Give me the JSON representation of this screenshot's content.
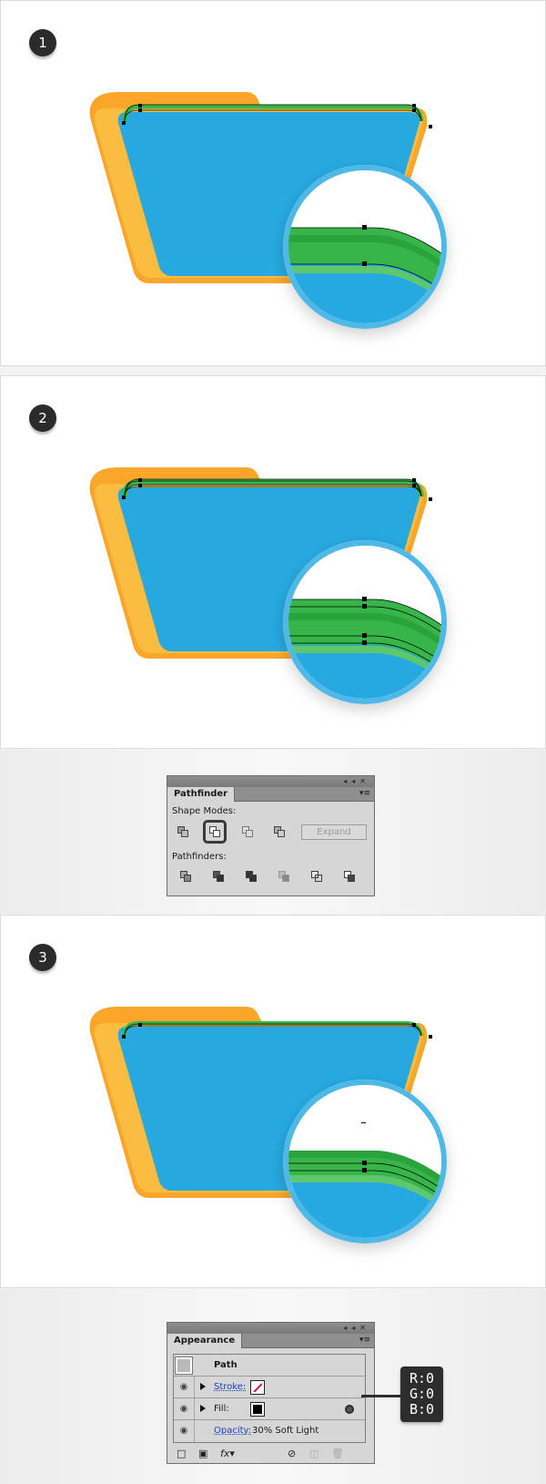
{
  "steps": [
    {
      "number": "1"
    },
    {
      "number": "2"
    },
    {
      "number": "3"
    }
  ],
  "colors": {
    "folder_back": "#f9a62b",
    "folder_front": "#27a9e0",
    "folder_rim": "#fbbd40",
    "green_strip": "#39b54a",
    "green_dark": "#2aa33c",
    "green_light": "#5dc76e",
    "badge_bg": "#2b2b2b"
  },
  "pathfinder_panel": {
    "title": "Pathfinder",
    "collapse_icon": "◂◂",
    "close_icon": "✕",
    "menu_icon": "▾≡",
    "shape_modes_label": "Shape Modes:",
    "shape_modes": [
      "unite",
      "minus-front",
      "intersect",
      "exclude"
    ],
    "selected_mode": "minus-front",
    "expand_label": "Expand",
    "pathfinders_label": "Pathfinders:",
    "pathfinders": [
      "divide",
      "trim",
      "merge",
      "crop",
      "outline",
      "minus-back"
    ]
  },
  "appearance_panel": {
    "title": "Appearance",
    "collapse_icon": "◂◂",
    "close_icon": "✕",
    "menu_icon": "▾≡",
    "object_label": "Path",
    "rows": [
      {
        "label": "Stroke:",
        "swatch": "none"
      },
      {
        "label": "Fill:",
        "swatch": "#000000"
      },
      {
        "label": "Opacity:",
        "value": "30% Soft Light"
      }
    ]
  },
  "callout": {
    "lines": [
      "R:0",
      "G:0",
      "B:0"
    ]
  }
}
